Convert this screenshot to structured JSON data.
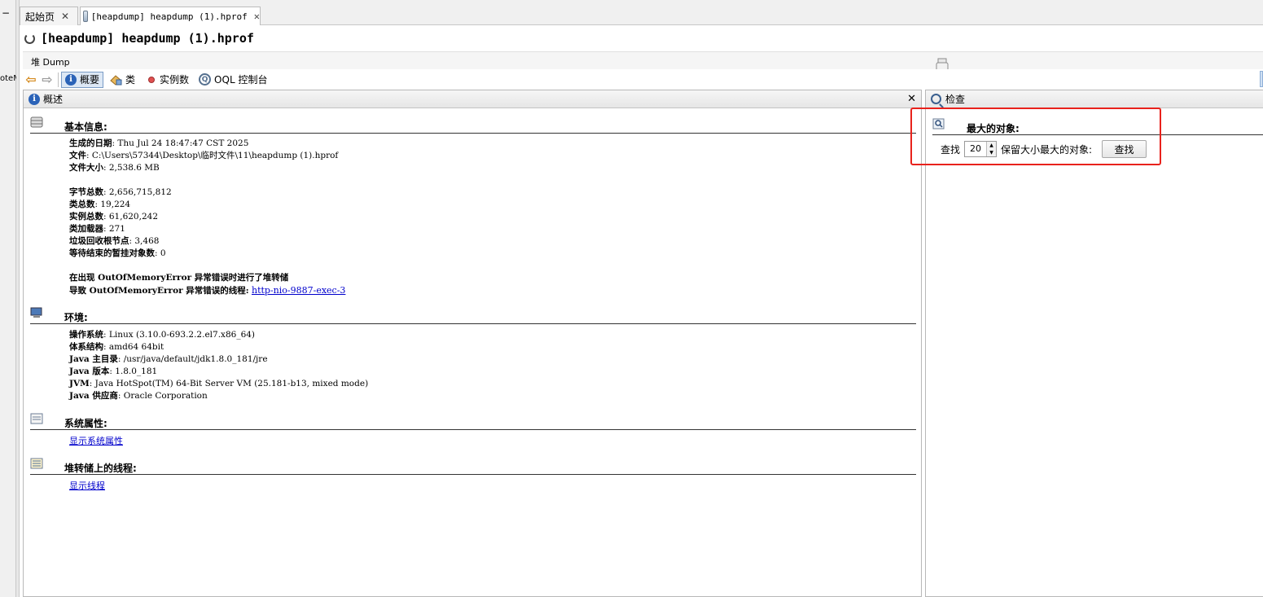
{
  "left_strip": {
    "minus": "−",
    "clipped_text": "oteM"
  },
  "tabs": [
    {
      "label": "起始页",
      "close": "✕"
    },
    {
      "label": "[heapdump] heapdump (1).hprof",
      "close": "✕"
    }
  ],
  "document": {
    "title": "[heapdump] heapdump (1).hprof"
  },
  "heap_bar": {
    "label": "堆 Dump"
  },
  "toolbar": {
    "back": "⇦",
    "forward": "⇨",
    "summary": "概要",
    "classes": "类",
    "instances": "实例数",
    "oql": "OQL 控制台",
    "oql_icon_text": "Q",
    "info_icon_text": "i"
  },
  "left_panel": {
    "title": "概述",
    "close": "✕",
    "basic_info": {
      "heading": "基本信息:",
      "lines": [
        {
          "label": "生成的日期",
          "value": ": Thu Jul 24 18:47:47 CST 2025"
        },
        {
          "label": "文件",
          "value": ": C:\\Users\\57344\\Desktop\\临时文件\\11\\heapdump (1).hprof"
        },
        {
          "label": "文件大小",
          "value": ": 2,538.6 MB"
        },
        {
          "label": "字节总数",
          "value": ": 2,656,715,812"
        },
        {
          "label": "类总数",
          "value": ": 19,224"
        },
        {
          "label": "实例总数",
          "value": ": 61,620,242"
        },
        {
          "label": "类加载器",
          "value": ": 271"
        },
        {
          "label": "垃圾回收根节点",
          "value": ": 3,468"
        },
        {
          "label": "等待结束的暂挂对象数",
          "value": ": 0"
        }
      ],
      "oom_line": "在出现 OutOfMemoryError 异常错误时进行了堆转储",
      "oom_thread_label": "导致 OutOfMemoryError 异常错误的线程:",
      "oom_thread_link": "http-nio-9887-exec-3"
    },
    "environment": {
      "heading": "环境:",
      "lines": [
        {
          "label": "操作系统",
          "value": ": Linux (3.10.0-693.2.2.el7.x86_64)"
        },
        {
          "label": "体系结构",
          "value": ": amd64 64bit"
        },
        {
          "label": "Java 主目录",
          "value": ": /usr/java/default/jdk1.8.0_181/jre"
        },
        {
          "label": "Java 版本",
          "value": ": 1.8.0_181"
        },
        {
          "label": "JVM",
          "value": ": Java HotSpot(TM) 64-Bit Server VM (25.181-b13, mixed mode)"
        },
        {
          "label": "Java 供应商",
          "value": ": Oracle Corporation"
        }
      ]
    },
    "system_props": {
      "heading": "系统属性:",
      "link": "显示系统属性"
    },
    "threads": {
      "heading": "堆转储上的线程:",
      "link": "显示线程"
    }
  },
  "right_panel": {
    "title": "检查",
    "largest": {
      "heading": "最大的对象:",
      "find_label": "查找",
      "count": "20",
      "suffix": "保留大小最大的对象:",
      "button": "查找"
    }
  },
  "colors": {
    "highlight": "#e8221c",
    "link": "#0000cc",
    "accent": "#2b63b8"
  }
}
